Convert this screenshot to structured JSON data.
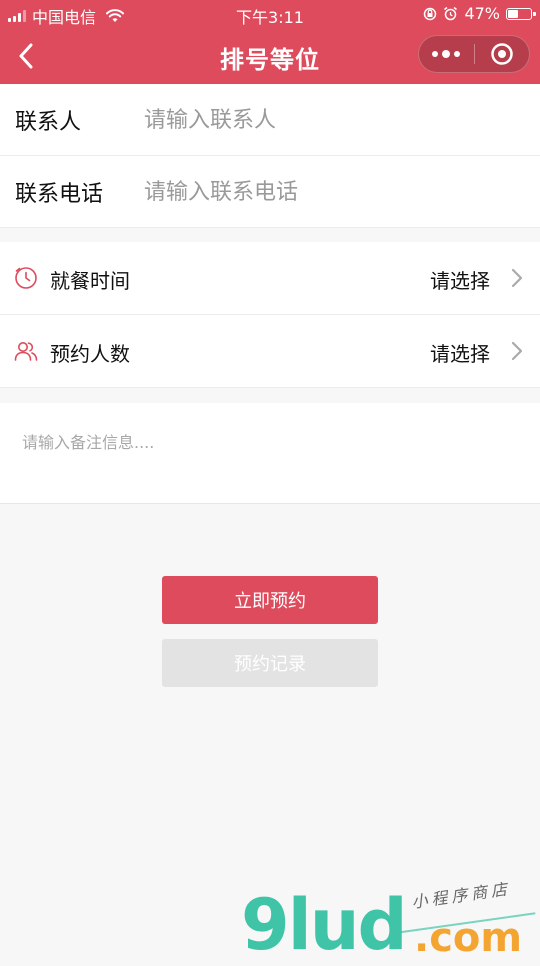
{
  "status_bar": {
    "carrier": "中国电信",
    "time": "下午3:11",
    "battery_text": "47%",
    "battery_level": 0.47
  },
  "nav": {
    "title": "排号等位"
  },
  "form": {
    "contact_label": "联系人",
    "contact_placeholder": "请输入联系人",
    "contact_value": "",
    "phone_label": "联系电话",
    "phone_placeholder": "请输入联系电话",
    "phone_value": ""
  },
  "options": [
    {
      "label": "就餐时间",
      "value": "请选择",
      "icon": "clock-icon"
    },
    {
      "label": "预约人数",
      "value": "请选择",
      "icon": "people-icon"
    }
  ],
  "remark": {
    "placeholder": "请输入备注信息....",
    "value": ""
  },
  "buttons": {
    "reserve": "立即预约",
    "records": "预约记录"
  },
  "watermark": {
    "logo": "9lud",
    "domain": ".com",
    "tagline": "小程序商店"
  },
  "colors": {
    "brand": "#de4b5c",
    "disabled_button": "#e3e3e3",
    "page_background": "#f7f7f7",
    "watermark_green": "#3fc4a8",
    "watermark_orange": "#f4a531"
  }
}
